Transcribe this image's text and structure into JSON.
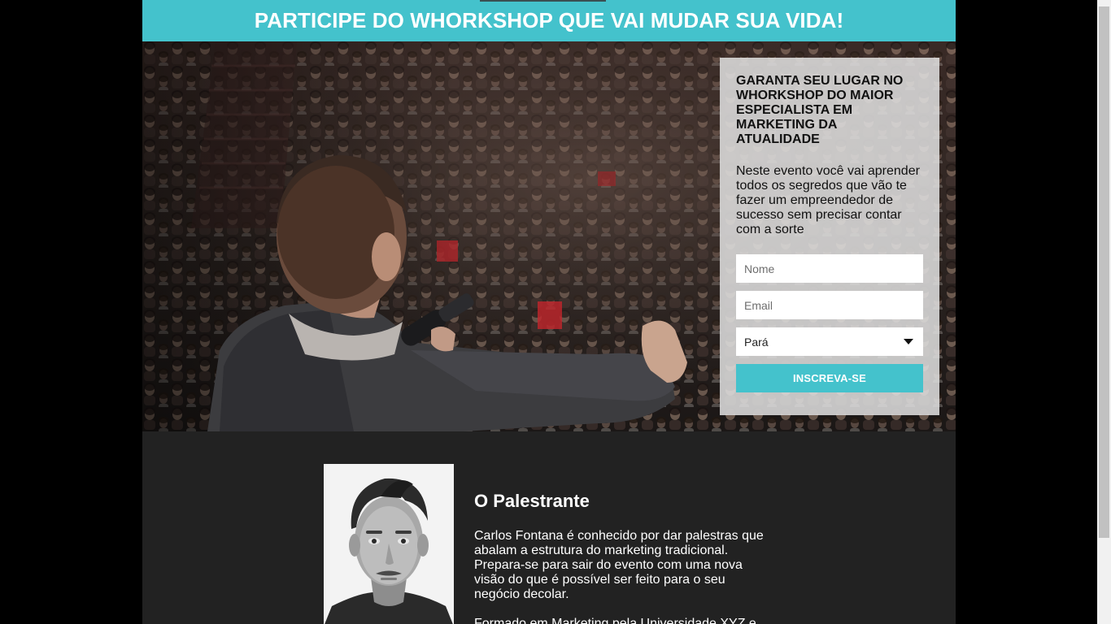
{
  "banner": {
    "title": "PARTICIPE DO WHORKSHOP QUE VAI MUDAR SUA VIDA!"
  },
  "signup": {
    "heading": "GARANTA SEU LUGAR NO WHORKSHOP DO MAIOR ESPECIALISTA EM MARKETING DA ATUALIDADE",
    "description": "Neste evento você vai aprender todos os segredos que vão te fazer um empreendedor de sucesso sem precisar contar com a sorte",
    "name_placeholder": "Nome",
    "email_placeholder": "Email",
    "state_selected": "Pará",
    "submit_label": "INSCREVA-SE"
  },
  "speaker": {
    "title": "O Palestrante",
    "bio": "Carlos Fontana é conhecido por dar palestras que abalam a estrutura do marketing tradicional. Prepara-se para sair do evento com uma nova visão do que é possível ser feito para o seu negócio decolar.",
    "bio_continued": "Formado em Marketing pela Universidade XYZ e"
  },
  "colors": {
    "accent": "#44c2cc",
    "page_background": "#222222",
    "outer_background": "#000000"
  }
}
